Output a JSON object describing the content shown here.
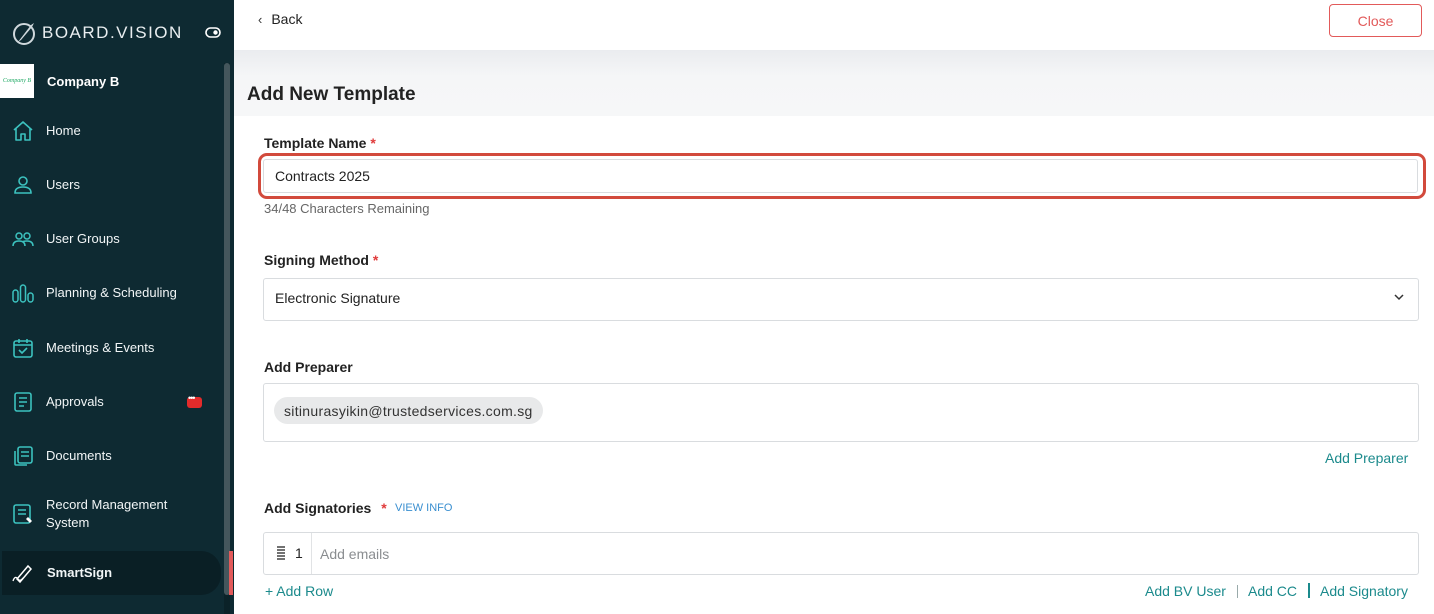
{
  "brand": {
    "name": "BOARD.VISION"
  },
  "company": {
    "logo_text": "Company B",
    "name": "Company B"
  },
  "sidebar": {
    "items": [
      {
        "label": "Home",
        "icon": "home-icon"
      },
      {
        "label": "Users",
        "icon": "user-icon"
      },
      {
        "label": "User Groups",
        "icon": "users-icon"
      },
      {
        "label": "Planning & Scheduling",
        "icon": "bar-chart-icon"
      },
      {
        "label": "Meetings & Events",
        "icon": "calendar-check-icon"
      },
      {
        "label": "Approvals",
        "icon": "document-icon",
        "badge": "chat-bubble-icon"
      },
      {
        "label": "Documents",
        "icon": "documents-icon"
      },
      {
        "label": "Record Management System",
        "icon": "record-icon"
      },
      {
        "label": "SmartSign",
        "icon": "pen-icon",
        "active": true
      }
    ]
  },
  "topbar": {
    "back_label": "Back",
    "close_label": "Close"
  },
  "page": {
    "title": "Add New Template"
  },
  "form": {
    "template_name": {
      "label": "Template Name",
      "required_mark": "*",
      "value": "Contracts 2025",
      "hint": "34/48 Characters Remaining"
    },
    "signing_method": {
      "label": "Signing Method",
      "required_mark": "*",
      "value": "Electronic Signature"
    },
    "preparer": {
      "label": "Add Preparer",
      "chip": "sitinurasyikin@trustedservices.com.sg",
      "add_link": "Add Preparer"
    },
    "signatories": {
      "label": "Add Signatories",
      "required_mark": "*",
      "view_info": "VIEW INFO",
      "rows": [
        {
          "number": "1",
          "placeholder": "Add emails"
        }
      ],
      "add_row": "+ Add Row",
      "add_bv_user": "Add BV User",
      "add_cc": "Add CC",
      "add_signatory": "Add Signatory"
    }
  },
  "colors": {
    "sidebar_bg": "#0e2a32",
    "accent_teal": "#1b8a8c",
    "danger": "#e25a5a",
    "highlight": "#d24a3c"
  }
}
